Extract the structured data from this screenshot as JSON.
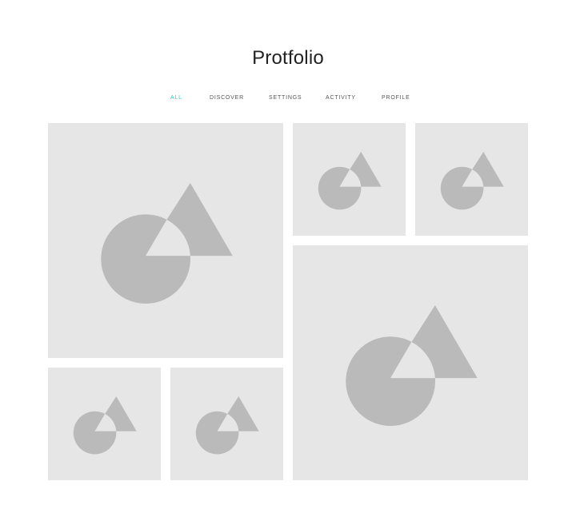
{
  "page": {
    "title": "Protfolio"
  },
  "nav": {
    "items": [
      {
        "label": "ALL",
        "active": true
      },
      {
        "label": "DISCOVER",
        "active": false
      },
      {
        "label": "SETTINGS",
        "active": false
      },
      {
        "label": "ACTIVITY",
        "active": false
      },
      {
        "label": "PROFILE",
        "active": false
      }
    ]
  },
  "gallery": {
    "tile_count": 6,
    "placeholder_icon": "image-placeholder-icon"
  },
  "colors": {
    "accent": "#3cc8b4",
    "tile_background": "#e6e6e6",
    "placeholder_shape": "#bababa",
    "text": "#222222",
    "nav_text": "#555555"
  }
}
